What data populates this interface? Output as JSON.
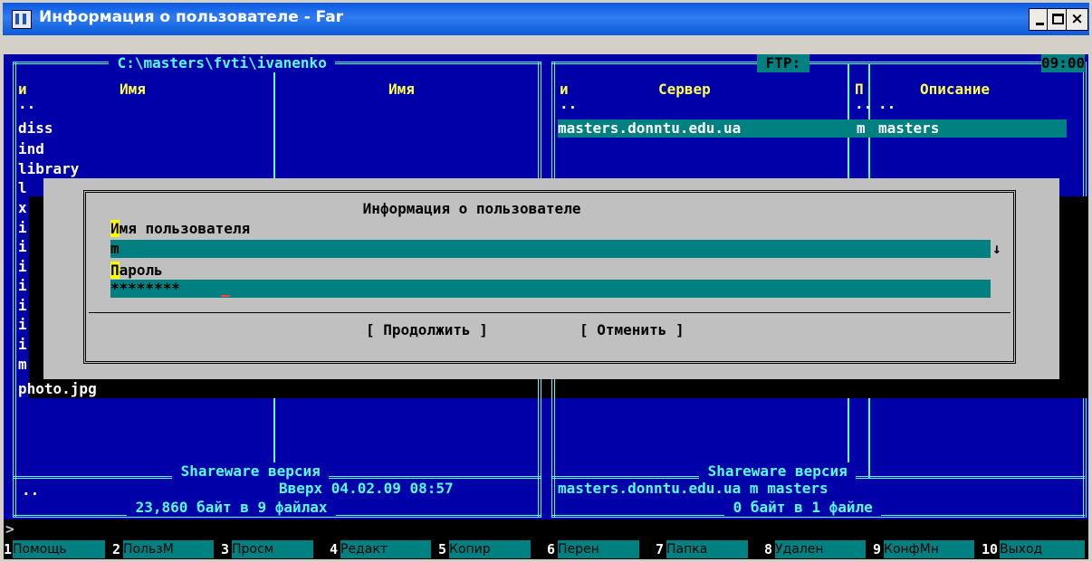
{
  "window": {
    "title": "Информация о пользователе - Far",
    "buttons": {
      "minimize": "_",
      "maximize": "□",
      "close": "×"
    }
  },
  "left_panel": {
    "path": " C:\\masters\\fvti\\ivanenko ",
    "col1_header": "и",
    "col2_header": "Имя",
    "col3_header": "Имя",
    "files": [
      "..",
      "diss",
      "ind",
      "library",
      "l",
      "x",
      "i",
      "i",
      "i",
      "i",
      "i",
      "i",
      "i",
      "m"
    ],
    "last_file": "photo.jpg",
    "footer_title": " Shareware версия ",
    "status_left": "..",
    "status_right": "Вверх 04.02.09 08:57",
    "summary": " 23,860 байт в 9 файлах "
  },
  "right_panel": {
    "title": " FTP: ",
    "clock": "09:00",
    "col1_header": "и",
    "col2_header": "Сервер",
    "col3_header": "П",
    "col4_header": "Описание",
    "row_up": {
      "c1": "..",
      "c3": "..",
      "c4": ".."
    },
    "row_server": {
      "host": "masters.donntu.edu.ua",
      "p": "m",
      "desc": "masters"
    },
    "footer_title": " Shareware версия ",
    "status": "masters.donntu.edu.ua m masters",
    "summary": " 0 байт в 1 файле "
  },
  "dialog": {
    "title": " Информация о пользователе ",
    "username_label": {
      "hotkey": "И",
      "rest": "мя пользователя"
    },
    "username_value": "m",
    "history_arrow": "↓",
    "password_label": {
      "hotkey": "П",
      "rest": "ароль"
    },
    "password_value": "********",
    "continue_button": "[ Продолжить ]",
    "cancel_button": "[ Отменить ]"
  },
  "command_line": {
    "prompt": ">"
  },
  "keybar": [
    {
      "num": "1",
      "label": "Помощь"
    },
    {
      "num": "2",
      "label": "ПользМ"
    },
    {
      "num": "3",
      "label": "Просм"
    },
    {
      "num": "4",
      "label": "Редакт"
    },
    {
      "num": "5",
      "label": "Копир"
    },
    {
      "num": "6",
      "label": "Перен"
    },
    {
      "num": "7",
      "label": "Папка"
    },
    {
      "num": "8",
      "label": "Удален"
    },
    {
      "num": "9",
      "label": "КонфМн"
    },
    {
      "num": "10",
      "label": "Выход"
    }
  ],
  "colors": {
    "console_bg": "#0000a8",
    "frame": "#54fcfc",
    "header": "#fcfc54",
    "selection": "#008080",
    "dialog_bg": "#c0c0c0",
    "title_bar": "#0a58e0"
  }
}
